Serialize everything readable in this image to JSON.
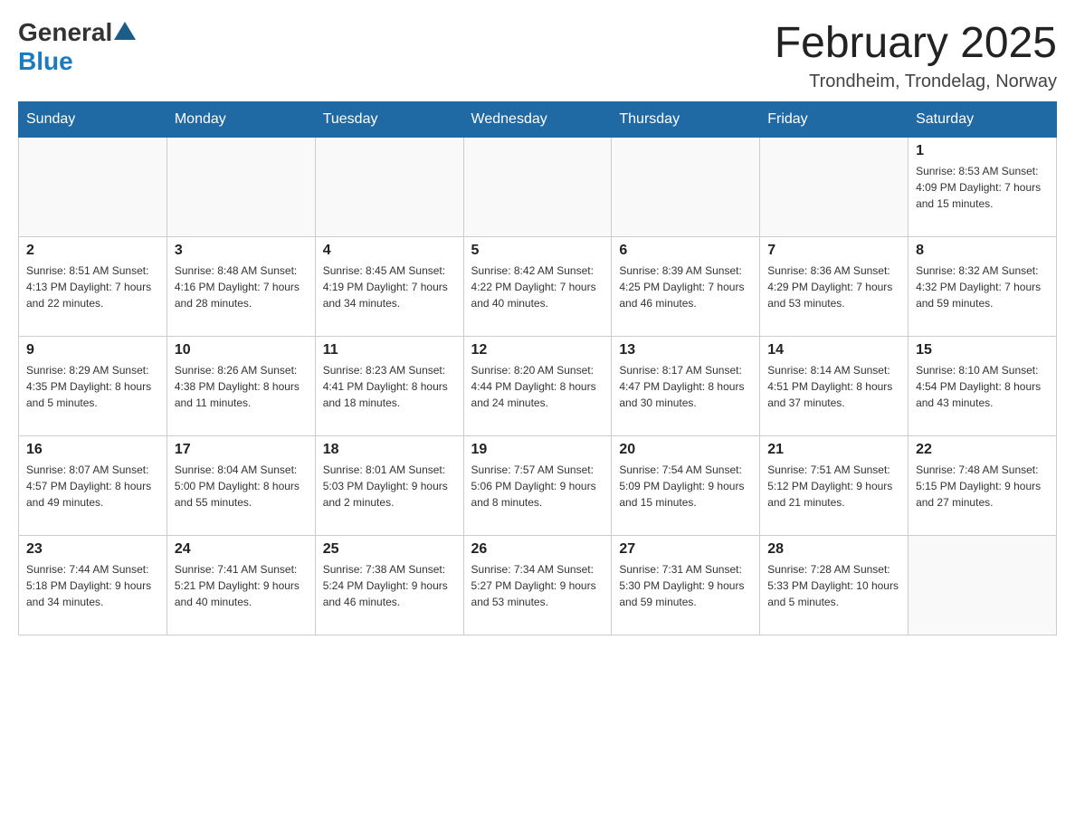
{
  "header": {
    "logo": {
      "general": "General",
      "blue": "Blue"
    },
    "title": "February 2025",
    "location": "Trondheim, Trondelag, Norway"
  },
  "calendar": {
    "weekdays": [
      "Sunday",
      "Monday",
      "Tuesday",
      "Wednesday",
      "Thursday",
      "Friday",
      "Saturday"
    ],
    "weeks": [
      [
        {
          "day": "",
          "info": ""
        },
        {
          "day": "",
          "info": ""
        },
        {
          "day": "",
          "info": ""
        },
        {
          "day": "",
          "info": ""
        },
        {
          "day": "",
          "info": ""
        },
        {
          "day": "",
          "info": ""
        },
        {
          "day": "1",
          "info": "Sunrise: 8:53 AM\nSunset: 4:09 PM\nDaylight: 7 hours\nand 15 minutes."
        }
      ],
      [
        {
          "day": "2",
          "info": "Sunrise: 8:51 AM\nSunset: 4:13 PM\nDaylight: 7 hours\nand 22 minutes."
        },
        {
          "day": "3",
          "info": "Sunrise: 8:48 AM\nSunset: 4:16 PM\nDaylight: 7 hours\nand 28 minutes."
        },
        {
          "day": "4",
          "info": "Sunrise: 8:45 AM\nSunset: 4:19 PM\nDaylight: 7 hours\nand 34 minutes."
        },
        {
          "day": "5",
          "info": "Sunrise: 8:42 AM\nSunset: 4:22 PM\nDaylight: 7 hours\nand 40 minutes."
        },
        {
          "day": "6",
          "info": "Sunrise: 8:39 AM\nSunset: 4:25 PM\nDaylight: 7 hours\nand 46 minutes."
        },
        {
          "day": "7",
          "info": "Sunrise: 8:36 AM\nSunset: 4:29 PM\nDaylight: 7 hours\nand 53 minutes."
        },
        {
          "day": "8",
          "info": "Sunrise: 8:32 AM\nSunset: 4:32 PM\nDaylight: 7 hours\nand 59 minutes."
        }
      ],
      [
        {
          "day": "9",
          "info": "Sunrise: 8:29 AM\nSunset: 4:35 PM\nDaylight: 8 hours\nand 5 minutes."
        },
        {
          "day": "10",
          "info": "Sunrise: 8:26 AM\nSunset: 4:38 PM\nDaylight: 8 hours\nand 11 minutes."
        },
        {
          "day": "11",
          "info": "Sunrise: 8:23 AM\nSunset: 4:41 PM\nDaylight: 8 hours\nand 18 minutes."
        },
        {
          "day": "12",
          "info": "Sunrise: 8:20 AM\nSunset: 4:44 PM\nDaylight: 8 hours\nand 24 minutes."
        },
        {
          "day": "13",
          "info": "Sunrise: 8:17 AM\nSunset: 4:47 PM\nDaylight: 8 hours\nand 30 minutes."
        },
        {
          "day": "14",
          "info": "Sunrise: 8:14 AM\nSunset: 4:51 PM\nDaylight: 8 hours\nand 37 minutes."
        },
        {
          "day": "15",
          "info": "Sunrise: 8:10 AM\nSunset: 4:54 PM\nDaylight: 8 hours\nand 43 minutes."
        }
      ],
      [
        {
          "day": "16",
          "info": "Sunrise: 8:07 AM\nSunset: 4:57 PM\nDaylight: 8 hours\nand 49 minutes."
        },
        {
          "day": "17",
          "info": "Sunrise: 8:04 AM\nSunset: 5:00 PM\nDaylight: 8 hours\nand 55 minutes."
        },
        {
          "day": "18",
          "info": "Sunrise: 8:01 AM\nSunset: 5:03 PM\nDaylight: 9 hours\nand 2 minutes."
        },
        {
          "day": "19",
          "info": "Sunrise: 7:57 AM\nSunset: 5:06 PM\nDaylight: 9 hours\nand 8 minutes."
        },
        {
          "day": "20",
          "info": "Sunrise: 7:54 AM\nSunset: 5:09 PM\nDaylight: 9 hours\nand 15 minutes."
        },
        {
          "day": "21",
          "info": "Sunrise: 7:51 AM\nSunset: 5:12 PM\nDaylight: 9 hours\nand 21 minutes."
        },
        {
          "day": "22",
          "info": "Sunrise: 7:48 AM\nSunset: 5:15 PM\nDaylight: 9 hours\nand 27 minutes."
        }
      ],
      [
        {
          "day": "23",
          "info": "Sunrise: 7:44 AM\nSunset: 5:18 PM\nDaylight: 9 hours\nand 34 minutes."
        },
        {
          "day": "24",
          "info": "Sunrise: 7:41 AM\nSunset: 5:21 PM\nDaylight: 9 hours\nand 40 minutes."
        },
        {
          "day": "25",
          "info": "Sunrise: 7:38 AM\nSunset: 5:24 PM\nDaylight: 9 hours\nand 46 minutes."
        },
        {
          "day": "26",
          "info": "Sunrise: 7:34 AM\nSunset: 5:27 PM\nDaylight: 9 hours\nand 53 minutes."
        },
        {
          "day": "27",
          "info": "Sunrise: 7:31 AM\nSunset: 5:30 PM\nDaylight: 9 hours\nand 59 minutes."
        },
        {
          "day": "28",
          "info": "Sunrise: 7:28 AM\nSunset: 5:33 PM\nDaylight: 10 hours\nand 5 minutes."
        },
        {
          "day": "",
          "info": ""
        }
      ]
    ]
  }
}
